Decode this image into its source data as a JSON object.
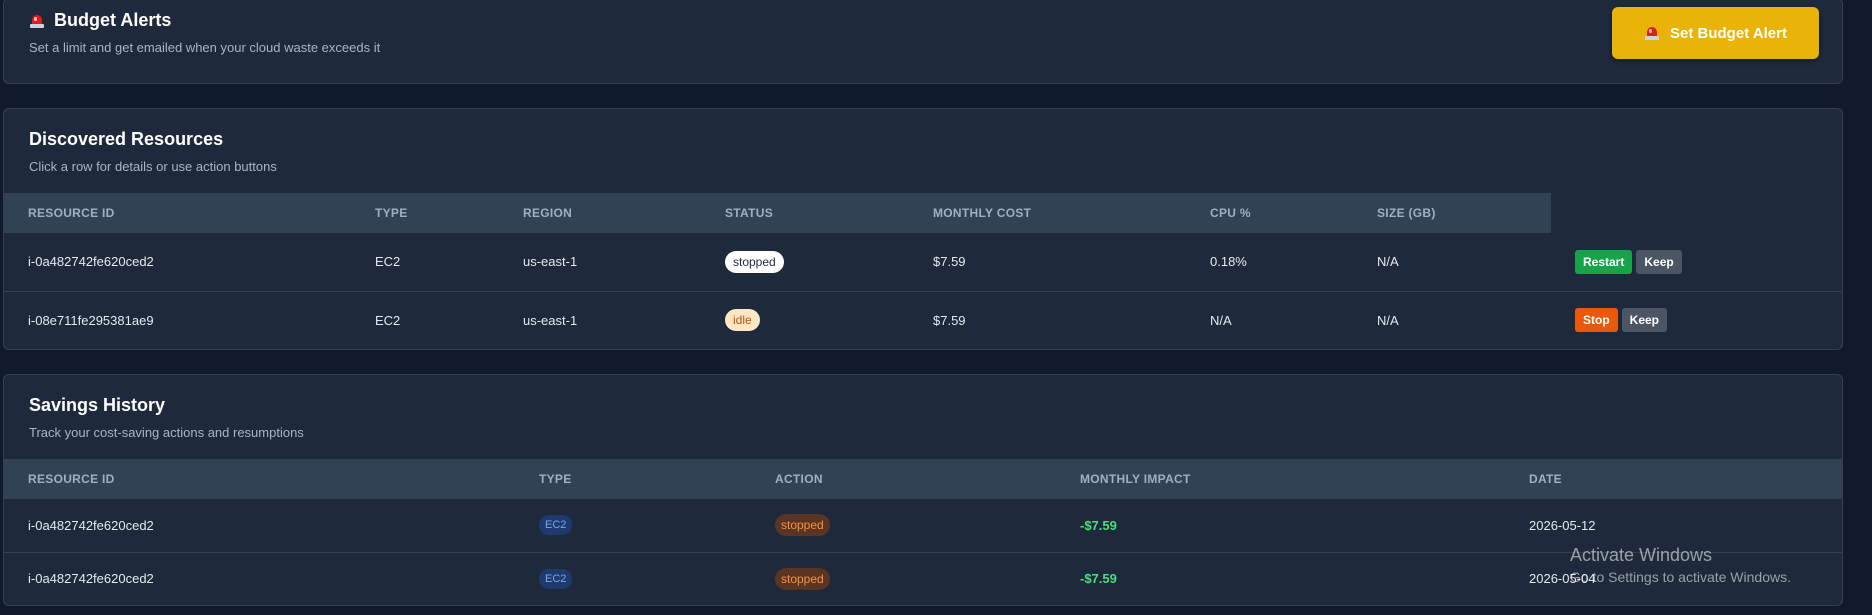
{
  "budget": {
    "title": "Budget Alerts",
    "subtitle": "Set a limit and get emailed when your cloud waste exceeds it",
    "button_label": "Set Budget Alert"
  },
  "resources": {
    "title": "Discovered Resources",
    "subtitle": "Click a row for details or use action buttons",
    "columns": [
      "Resource ID",
      "Type",
      "Region",
      "Status",
      "Monthly Cost",
      "CPU %",
      "Size (GB)"
    ],
    "rows": [
      {
        "id": "i-0a482742fe620ced2",
        "type": "EC2",
        "region": "us-east-1",
        "status": "stopped",
        "cost": "$7.59",
        "cpu": "0.18%",
        "size": "N/A",
        "primary_action": "Restart",
        "secondary_action": "Keep"
      },
      {
        "id": "i-08e711fe295381ae9",
        "type": "EC2",
        "region": "us-east-1",
        "status": "idle",
        "cost": "$7.59",
        "cpu": "N/A",
        "size": "N/A",
        "primary_action": "Stop",
        "secondary_action": "Keep"
      }
    ]
  },
  "history": {
    "title": "Savings History",
    "subtitle": "Track your cost-saving actions and resumptions",
    "columns": [
      "Resource ID",
      "Type",
      "Action",
      "Monthly Impact",
      "Date"
    ],
    "rows": [
      {
        "id": "i-0a482742fe620ced2",
        "type": "EC2",
        "action": "stopped",
        "impact": "-$7.59",
        "date": "2026-05-12"
      },
      {
        "id": "i-0a482742fe620ced2",
        "type": "EC2",
        "action": "stopped",
        "impact": "-$7.59",
        "date": "2026-05-04"
      }
    ]
  },
  "watermark": {
    "title": "Activate Windows",
    "subtitle": "Go to Settings to activate Windows."
  },
  "colors": {
    "background": "#111a2a",
    "card": "#1e293b",
    "accent_yellow": "#eab308",
    "restart_green": "#16a34a",
    "stop_orange": "#ea580c",
    "keep_gray": "#4b5563",
    "impact_green": "#4ade80"
  },
  "icons": {
    "budget_title": "siren-icon",
    "budget_button": "siren-icon"
  }
}
